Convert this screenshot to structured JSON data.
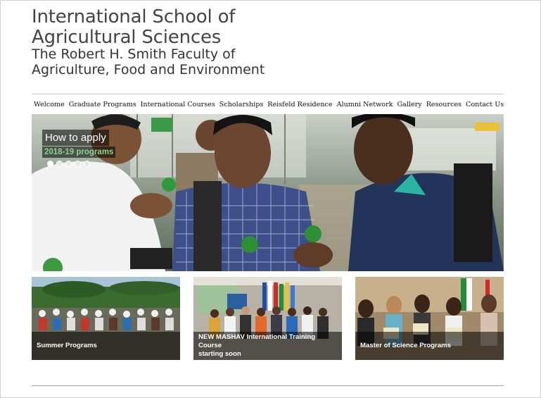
{
  "header": {
    "title_line1": "International School of",
    "title_line2": "Agricultural Sciences",
    "subtitle_line1": "The Robert H. Smith Faculty of",
    "subtitle_line2": "Agriculture, Food and Environment"
  },
  "nav": {
    "items": [
      {
        "label": "Welcome"
      },
      {
        "label": "Graduate Programs"
      },
      {
        "label": "International Courses"
      },
      {
        "label": "Scholarships"
      },
      {
        "label": "Reisfeld Residence"
      },
      {
        "label": "Alumni Network"
      },
      {
        "label": "Gallery"
      },
      {
        "label": "Resources"
      },
      {
        "label": "Contact Us"
      }
    ]
  },
  "hero": {
    "caption_title": "How to apply",
    "caption_subtitle": "2018-19 programs",
    "slides_count": 5,
    "active_slide": 1,
    "caption_subtitle_color": "#8fd08a"
  },
  "tiles": [
    {
      "label": "Summer Programs"
    },
    {
      "label_line1": "NEW MASHAV International Training Course",
      "label_line2": "starting soon"
    },
    {
      "label": "Master of Science Programs"
    }
  ]
}
